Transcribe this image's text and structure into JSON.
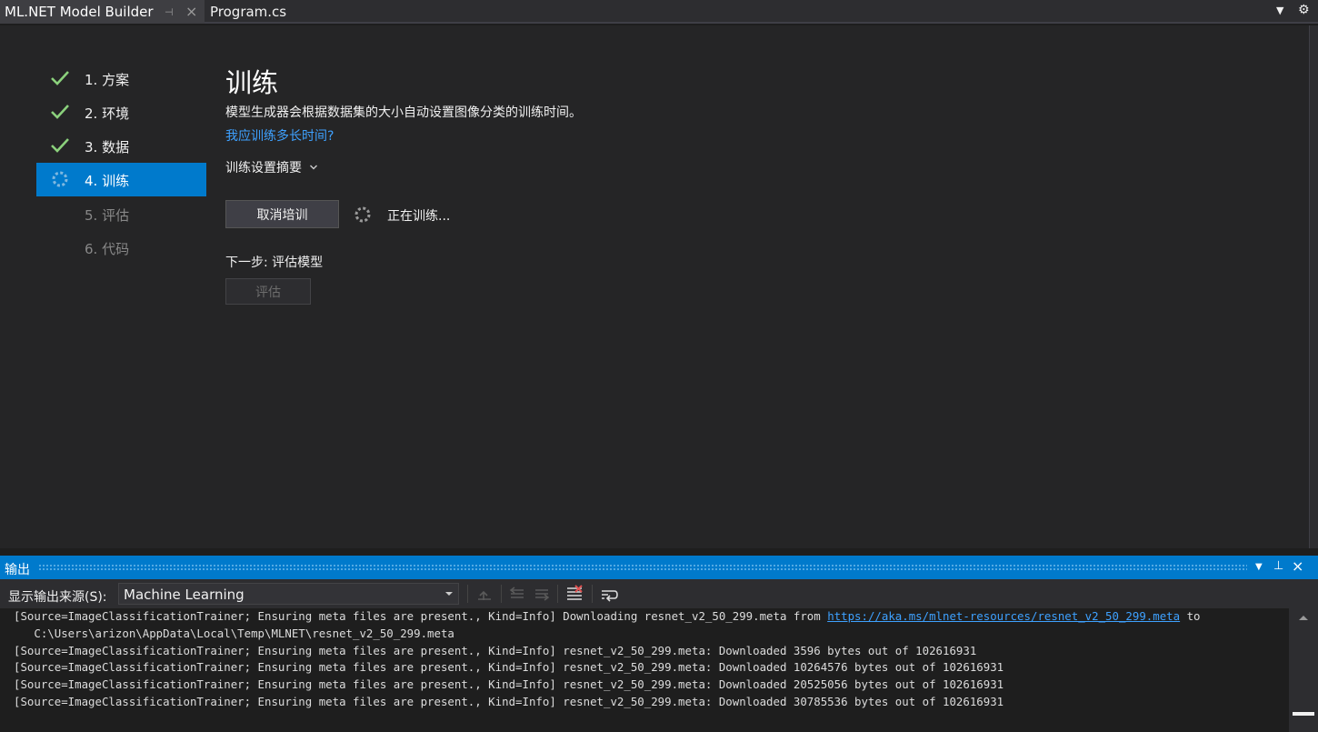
{
  "tabs": {
    "active": "ML.NET Model Builder",
    "inactive": "Program.cs"
  },
  "steps": [
    {
      "label": "1. 方案",
      "status": "done"
    },
    {
      "label": "2. 环境",
      "status": "done"
    },
    {
      "label": "3. 数据",
      "status": "done"
    },
    {
      "label": "4. 训练",
      "status": "active"
    },
    {
      "label": "5. 评估",
      "status": "pending"
    },
    {
      "label": "6. 代码",
      "status": "pending"
    }
  ],
  "main": {
    "title": "训练",
    "description": "模型生成器会根据数据集的大小自动设置图像分类的训练时间。",
    "help_link": "我应训练多长时间?",
    "summary_label": "训练设置摘要",
    "cancel_button": "取消培训",
    "training_status": "正在训练...",
    "next_step": "下一步: 评估模型",
    "evaluate_button": "评估"
  },
  "output": {
    "title": "输出",
    "source_label": "显示输出来源(S):",
    "source_value": "Machine Learning",
    "log_lines": [
      {
        "text": "[Source=ImageClassificationTrainer; Ensuring meta files are present., Kind=Info] Downloading resnet_v2_50_299.meta from ",
        "link": "https://aka.ms/mlnet-resources/resnet_v2_50_299.meta",
        "tail": " to"
      },
      {
        "text": "   C:\\Users\\arizon\\AppData\\Local\\Temp\\MLNET\\resnet_v2_50_299.meta"
      },
      {
        "text": "[Source=ImageClassificationTrainer; Ensuring meta files are present., Kind=Info] resnet_v2_50_299.meta: Downloaded 3596 bytes out of 102616931"
      },
      {
        "text": "[Source=ImageClassificationTrainer; Ensuring meta files are present., Kind=Info] resnet_v2_50_299.meta: Downloaded 10264576 bytes out of 102616931"
      },
      {
        "text": "[Source=ImageClassificationTrainer; Ensuring meta files are present., Kind=Info] resnet_v2_50_299.meta: Downloaded 20525056 bytes out of 102616931"
      },
      {
        "text": "[Source=ImageClassificationTrainer; Ensuring meta files are present., Kind=Info] resnet_v2_50_299.meta: Downloaded 30785536 bytes out of 102616931"
      }
    ]
  },
  "colors": {
    "accent": "#007acc",
    "check": "#8bd17c",
    "link": "#3ea1ff"
  }
}
